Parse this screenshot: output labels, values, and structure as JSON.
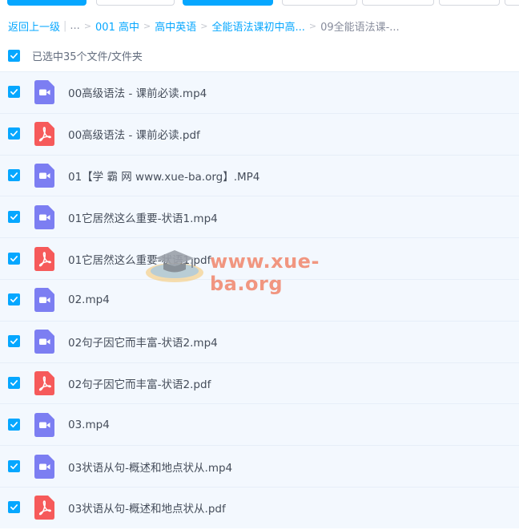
{
  "breadcrumb": {
    "back": "返回上一级",
    "more": "...",
    "items": [
      "001 高中",
      "高中英语",
      "全能语法课初中高...",
      "09全能语法课-..."
    ]
  },
  "selection": {
    "label": "已选中35个文件/文件夹"
  },
  "files": [
    {
      "name": "00高级语法 - 课前必读.mp4",
      "type": "video"
    },
    {
      "name": "00高级语法 - 课前必读.pdf",
      "type": "pdf"
    },
    {
      "name": "01【学 霸 网 www.xue-ba.org】.MP4",
      "type": "video"
    },
    {
      "name": "01它居然这么重要-状语1.mp4",
      "type": "video"
    },
    {
      "name": "01它居然这么重要-状语1.pdf",
      "type": "pdf"
    },
    {
      "name": "02.mp4",
      "type": "video"
    },
    {
      "name": "02句子因它而丰富-状语2.mp4",
      "type": "video"
    },
    {
      "name": "02句子因它而丰富-状语2.pdf",
      "type": "pdf"
    },
    {
      "name": "03.mp4",
      "type": "video"
    },
    {
      "name": "03状语从句-概述和地点状从.mp4",
      "type": "video"
    },
    {
      "name": "03状语从句-概述和地点状从.pdf",
      "type": "pdf"
    }
  ],
  "watermark": {
    "text": "www.xue-ba.org"
  },
  "colors": {
    "accent": "#06a7ff",
    "row_bg": "#f3f8fe",
    "video_icon": "#7c7ef2",
    "pdf_icon": "#f65a5a"
  }
}
